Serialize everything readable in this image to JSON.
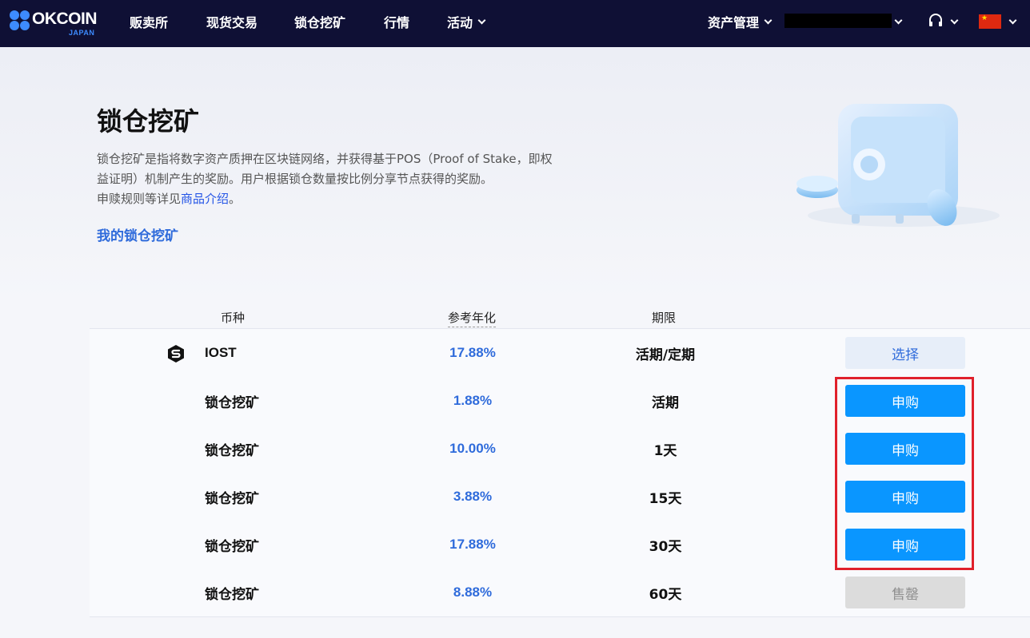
{
  "nav": {
    "logo_text": "OKCOIN",
    "logo_sub": "JAPAN",
    "items": [
      "贩卖所",
      "现货交易",
      "锁仓挖矿",
      "行情",
      "活动"
    ],
    "asset_mgmt": "资产管理"
  },
  "hero": {
    "title": "锁仓挖矿",
    "desc_line1": "锁仓挖矿是指将数字资产质押在区块链网络，并获得基于POS（Proof of Stake，即权",
    "desc_line2": "益证明）机制产生的奖励。用户根据锁仓数量按比例分享节点获得的奖励。",
    "desc_line3_prefix": "申赎规则等详见",
    "desc_line3_link": "商品介绍",
    "desc_line3_suffix": "。",
    "my_link": "我的锁仓挖矿"
  },
  "table": {
    "headers": {
      "coin": "币种",
      "rate": "参考年化",
      "term": "期限"
    },
    "coin_row": {
      "coin": "IOST",
      "rate": "17.88%",
      "term": "活期/定期",
      "button": "选择"
    },
    "products": [
      {
        "name": "锁仓挖矿",
        "rate": "1.88%",
        "term": "活期",
        "button": "申购",
        "status": "buy"
      },
      {
        "name": "锁仓挖矿",
        "rate": "10.00%",
        "term": "1天",
        "button": "申购",
        "status": "buy"
      },
      {
        "name": "锁仓挖矿",
        "rate": "3.88%",
        "term": "15天",
        "button": "申购",
        "status": "buy"
      },
      {
        "name": "锁仓挖矿",
        "rate": "17.88%",
        "term": "30天",
        "button": "申购",
        "status": "buy"
      },
      {
        "name": "锁仓挖矿",
        "rate": "8.88%",
        "term": "60天",
        "button": "售罄",
        "status": "soldout"
      }
    ]
  },
  "colors": {
    "nav_bg": "#0f1035",
    "accent_blue": "#0a96ff",
    "rate_blue": "#2f6bdb",
    "highlight_red": "#e0202b"
  }
}
